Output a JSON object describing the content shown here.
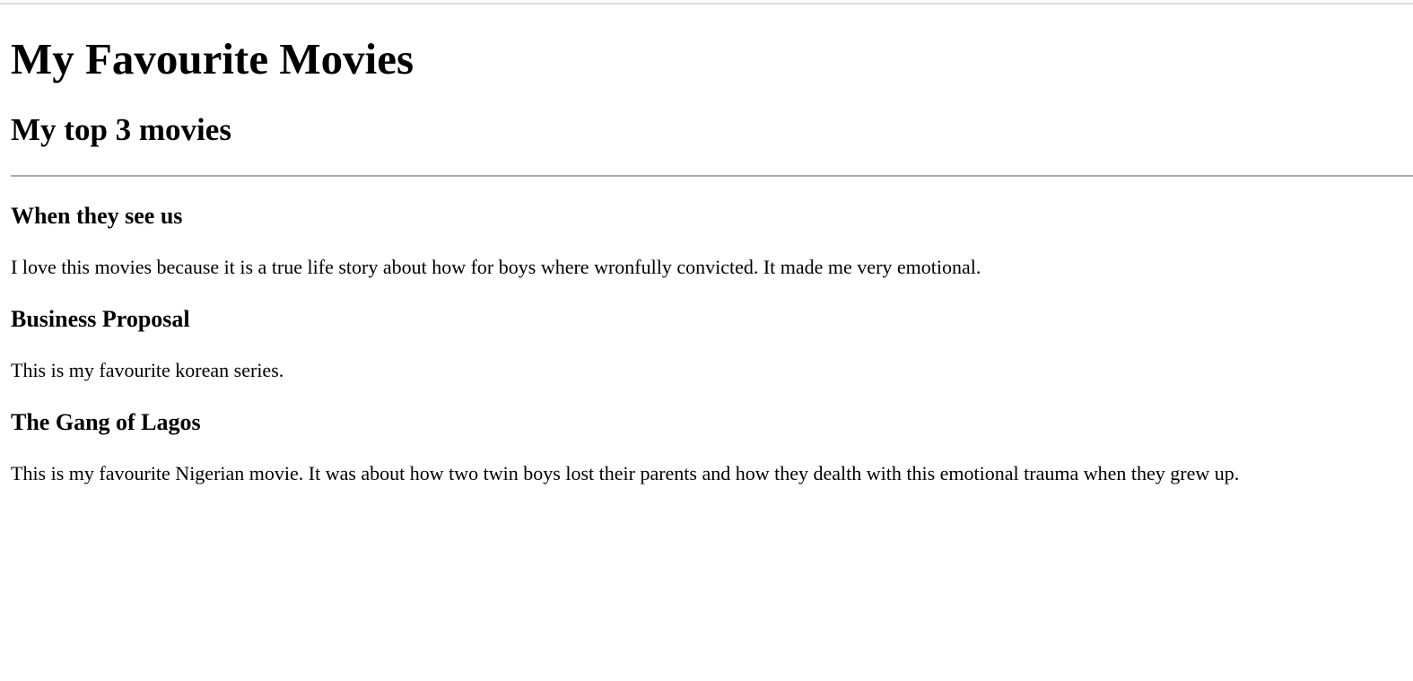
{
  "page": {
    "title": "My Favourite Movies",
    "subtitle": "My top 3 movies"
  },
  "movies": [
    {
      "title": "When they see us",
      "description": "I love this movies because it is a true life story about how for boys where wronfully convicted. It made me very emotional."
    },
    {
      "title": "Business Proposal",
      "description": "This is my favourite korean series."
    },
    {
      "title": "The Gang of Lagos",
      "description": "This is my favourite Nigerian movie. It was about how two twin boys lost their parents and how they dealth with this emotional trauma when they grew up."
    }
  ]
}
